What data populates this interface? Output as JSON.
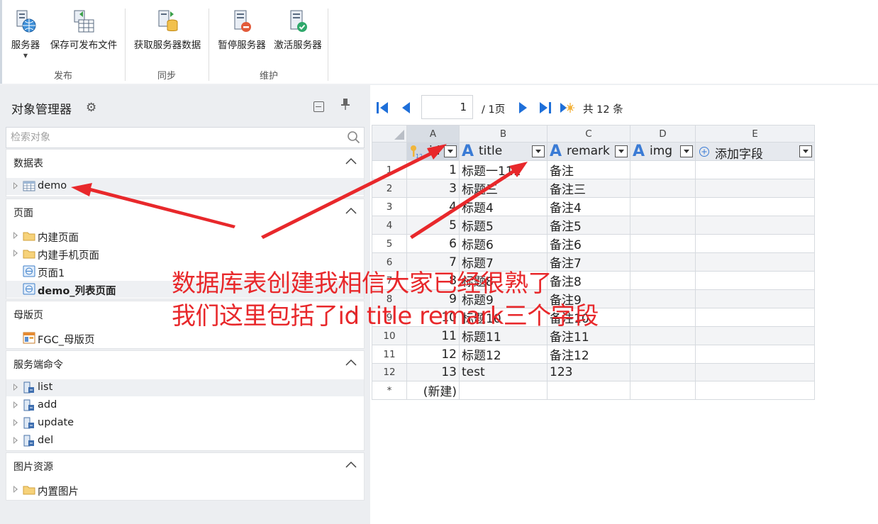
{
  "ribbon": {
    "buttons": [
      {
        "label": "服务器",
        "icon": "server-globe-icon"
      },
      {
        "label": "保存可发布文件",
        "icon": "save-publish-icon"
      },
      {
        "label": "获取服务器数据",
        "icon": "fetch-server-data-icon"
      },
      {
        "label": "暂停服务器",
        "icon": "pause-server-icon"
      },
      {
        "label": "激活服务器",
        "icon": "activate-server-icon"
      }
    ],
    "groups": [
      "发布",
      "同步",
      "维护"
    ]
  },
  "panel": {
    "title": "对象管理器",
    "search_placeholder": "检索对象",
    "sections": [
      {
        "title": "数据表",
        "items": [
          {
            "label": "demo",
            "icon": "table-icon"
          }
        ]
      },
      {
        "title": "页面",
        "items": [
          {
            "label": "内建页面",
            "icon": "folder-icon"
          },
          {
            "label": "内建手机页面",
            "icon": "folder-icon"
          },
          {
            "label": "页面1",
            "icon": "page-icon"
          },
          {
            "label": "demo_列表页面",
            "icon": "page-icon"
          }
        ]
      },
      {
        "title": "母版页",
        "items": [
          {
            "label": "FGC_母版页",
            "icon": "master-page-icon"
          }
        ]
      },
      {
        "title": "服务端命令",
        "items": [
          {
            "label": "list",
            "icon": "command-icon"
          },
          {
            "label": "add",
            "icon": "command-icon"
          },
          {
            "label": "update",
            "icon": "command-icon"
          },
          {
            "label": "del",
            "icon": "command-icon"
          }
        ]
      },
      {
        "title": "图片资源",
        "items": [
          {
            "label": "内置图片",
            "icon": "folder-icon"
          }
        ]
      }
    ]
  },
  "pager": {
    "current_page": "1",
    "total_pages": "/ 1页",
    "record_count": "共 12 条"
  },
  "grid": {
    "column_letters": [
      "A",
      "B",
      "C",
      "D",
      "E"
    ],
    "fields": [
      "id",
      "title",
      "remark",
      "img",
      "添加字段"
    ],
    "rows": [
      {
        "n": "1",
        "id": "1",
        "title": "标题一111",
        "remark": "备注"
      },
      {
        "n": "2",
        "id": "3",
        "title": "标题三",
        "remark": "备注三"
      },
      {
        "n": "3",
        "id": "4",
        "title": "标题4",
        "remark": "备注4"
      },
      {
        "n": "4",
        "id": "5",
        "title": "标题5",
        "remark": "备注5"
      },
      {
        "n": "5",
        "id": "6",
        "title": "标题6",
        "remark": "备注6"
      },
      {
        "n": "6",
        "id": "7",
        "title": "标题7",
        "remark": "备注7"
      },
      {
        "n": "7",
        "id": "8",
        "title": "标题8",
        "remark": "备注8"
      },
      {
        "n": "8",
        "id": "9",
        "title": "标题9",
        "remark": "备注9"
      },
      {
        "n": "9",
        "id": "10",
        "title": "标题10",
        "remark": "备注10"
      },
      {
        "n": "10",
        "id": "11",
        "title": "标题11",
        "remark": "备注11"
      },
      {
        "n": "11",
        "id": "12",
        "title": "标题12",
        "remark": "备注12"
      },
      {
        "n": "12",
        "id": "13",
        "title": "test",
        "remark": "123"
      }
    ],
    "new_row_marker": "*",
    "new_row_label": "(新建)"
  },
  "annotation": {
    "line1": "数据库表创建我相信大家已经很熟了",
    "line2": "我们这里包括了id title remark三个字段",
    "color": "#e8282b"
  }
}
